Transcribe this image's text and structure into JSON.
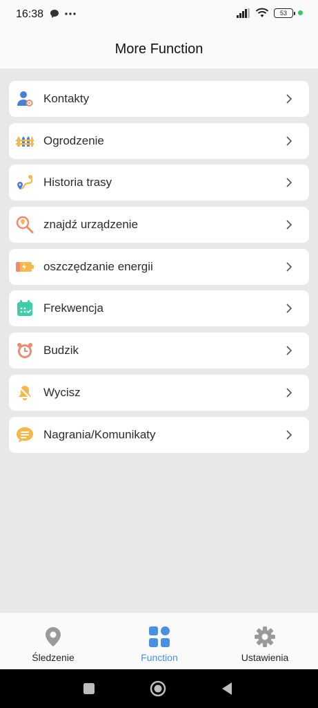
{
  "status": {
    "time": "16:38",
    "battery": "53"
  },
  "header": {
    "title": "More Function"
  },
  "menu": [
    {
      "label": "Kontakty",
      "icon": "contact-icon"
    },
    {
      "label": "Ogrodzenie",
      "icon": "fence-icon"
    },
    {
      "label": "Historia trasy",
      "icon": "route-history-icon"
    },
    {
      "label": "znajdź urządzenie",
      "icon": "find-device-icon"
    },
    {
      "label": "oszczędzanie energii",
      "icon": "battery-saver-icon"
    },
    {
      "label": "Frekwencja",
      "icon": "calendar-icon"
    },
    {
      "label": "Budzik",
      "icon": "alarm-clock-icon"
    },
    {
      "label": "Wycisz",
      "icon": "bell-mute-icon"
    },
    {
      "label": "Nagrania/Komunikaty",
      "icon": "message-icon"
    }
  ],
  "nav": {
    "tabs": [
      {
        "label": "Śledzenie",
        "icon": "location-pin-icon"
      },
      {
        "label": "Function",
        "icon": "grid-icon",
        "active": true
      },
      {
        "label": "Ustawienia",
        "icon": "gear-icon"
      }
    ]
  },
  "colors": {
    "accent": "#4a90e2",
    "background": "#e8e8e8"
  }
}
